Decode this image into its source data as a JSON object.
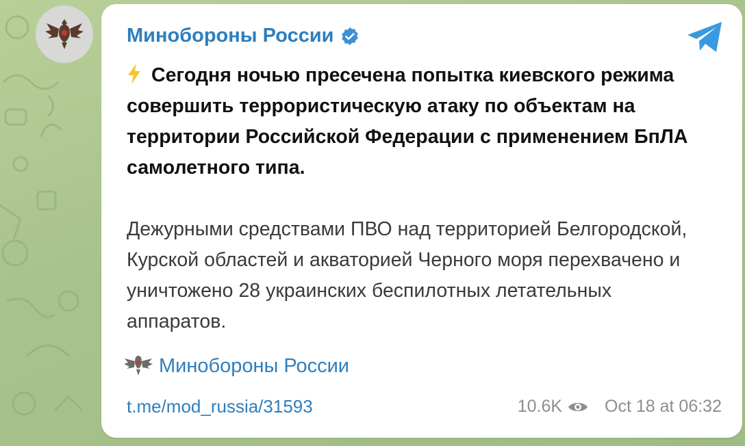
{
  "channel": {
    "name": "Минобороны России"
  },
  "message": {
    "lead_icon": "lightning-icon",
    "paragraph1": "Сегодня ночью пресечена попытка киевского режима совершить террористическую атаку по объектам на территории Российской Федерации с применением БпЛА самолетного типа.",
    "paragraph2": "Дежурными средствами ПВО над территорией Белгородской, Курской областей и акваторией Черного моря перехвачено и уничтожено 28 украинских беспилотных летательных аппаратов."
  },
  "signature": {
    "icon": "emblem-icon",
    "text": "Минобороны России"
  },
  "footer": {
    "link": "t.me/mod_russia/31593",
    "views": "10.6K",
    "views_icon": "eye-icon",
    "timestamp": "Oct 18 at 06:32"
  },
  "colors": {
    "accent": "#2e7ebd",
    "background": "#a9c38c",
    "bubble": "#ffffff",
    "meta_text": "#8a8e93"
  }
}
